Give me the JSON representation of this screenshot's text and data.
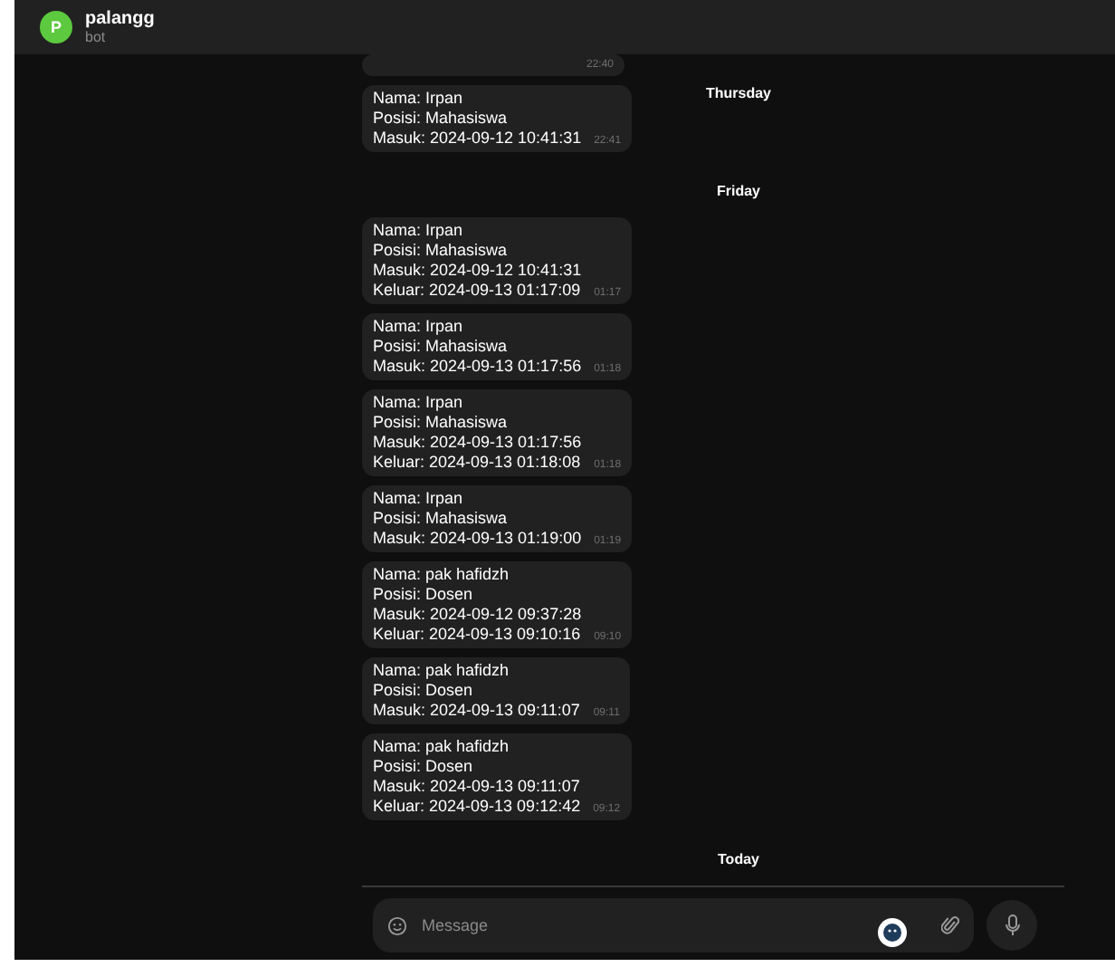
{
  "chat": {
    "title": "palangg",
    "subtitle": "bot",
    "avatar_letter": "P"
  },
  "sticky_date": "Thursday",
  "items": [
    {
      "kind": "message",
      "time": "22:40"
    },
    {
      "kind": "message",
      "lines": [
        "Nama: Irpan",
        "Posisi: Mahasiswa",
        "Masuk: 2024-09-12 10:41:31"
      ],
      "time": "22:41"
    },
    {
      "kind": "date",
      "label": "Friday"
    },
    {
      "kind": "message",
      "lines": [
        "Nama: Irpan",
        "Posisi: Mahasiswa",
        "Masuk: 2024-09-12 10:41:31",
        "Keluar: 2024-09-13 01:17:09"
      ],
      "time": "01:17"
    },
    {
      "kind": "message",
      "lines": [
        "Nama: Irpan",
        "Posisi: Mahasiswa",
        "Masuk: 2024-09-13 01:17:56"
      ],
      "time": "01:18"
    },
    {
      "kind": "message",
      "lines": [
        "Nama: Irpan",
        "Posisi: Mahasiswa",
        "Masuk: 2024-09-13 01:17:56",
        "Keluar: 2024-09-13 01:18:08"
      ],
      "time": "01:18"
    },
    {
      "kind": "message",
      "lines": [
        "Nama: Irpan",
        "Posisi: Mahasiswa",
        "Masuk: 2024-09-13 01:19:00"
      ],
      "time": "01:19"
    },
    {
      "kind": "message",
      "lines": [
        "Nama: pak hafidzh",
        "Posisi: Dosen",
        "Masuk: 2024-09-12 09:37:28",
        "Keluar: 2024-09-13 09:10:16"
      ],
      "time": "09:10"
    },
    {
      "kind": "message",
      "lines": [
        "Nama: pak hafidzh",
        "Posisi: Dosen",
        "Masuk: 2024-09-13 09:11:07"
      ],
      "time": "09:11"
    },
    {
      "kind": "message",
      "lines": [
        "Nama: pak hafidzh",
        "Posisi: Dosen",
        "Masuk: 2024-09-13 09:11:07",
        "Keluar: 2024-09-13 09:12:42"
      ],
      "time": "09:12"
    },
    {
      "kind": "date",
      "label": "Today"
    }
  ],
  "composer": {
    "placeholder": "Message"
  }
}
